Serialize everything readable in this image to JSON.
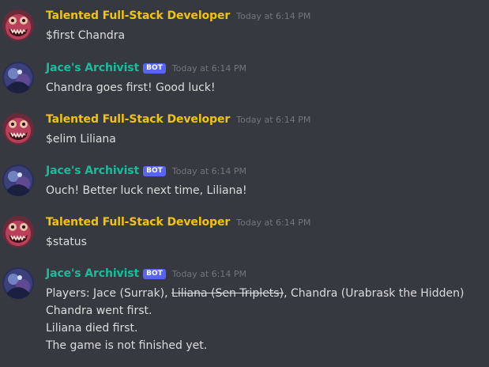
{
  "colors": {
    "background": "#36393f",
    "user_name": "#f1c40f",
    "bot_name": "#1abc9c",
    "bot_tag": "#5865f2",
    "timestamp": "#72767d",
    "text": "#dcddde"
  },
  "messages": [
    {
      "author": "Talented Full-Stack Developer",
      "is_bot": false,
      "time": "Today at 6:14 PM",
      "avatar": "monster-avatar",
      "lines": [
        "$first Chandra"
      ]
    },
    {
      "author": "Jace's Archivist",
      "is_bot": true,
      "bot_tag": "BOT",
      "time": "Today at 6:14 PM",
      "avatar": "archivist-avatar",
      "lines": [
        "Chandra goes first!  Good luck!"
      ]
    },
    {
      "author": "Talented Full-Stack Developer",
      "is_bot": false,
      "time": "Today at 6:14 PM",
      "avatar": "monster-avatar",
      "lines": [
        "$elim Liliana"
      ]
    },
    {
      "author": "Jace's Archivist",
      "is_bot": true,
      "bot_tag": "BOT",
      "time": "Today at 6:14 PM",
      "avatar": "archivist-avatar",
      "lines": [
        "Ouch! Better luck next time, Liliana!"
      ]
    },
    {
      "author": "Talented Full-Stack Developer",
      "is_bot": false,
      "time": "Today at 6:14 PM",
      "avatar": "monster-avatar",
      "lines": [
        "$status"
      ]
    },
    {
      "author": "Jace's Archivist",
      "is_bot": true,
      "bot_tag": "BOT",
      "time": "Today at 6:14 PM",
      "avatar": "archivist-avatar",
      "status": {
        "players_prefix": "Players: ",
        "player_1": "Jace (Surrak)",
        "separator_1": ", ",
        "player_2_eliminated": "Liliana (Sen Triplets)",
        "separator_2": ", ",
        "player_3": "Chandra (Urabrask the Hidden)",
        "line_2": "Chandra went first.",
        "line_3": "Liliana died first.",
        "line_4": "The game is not finished yet."
      }
    }
  ]
}
